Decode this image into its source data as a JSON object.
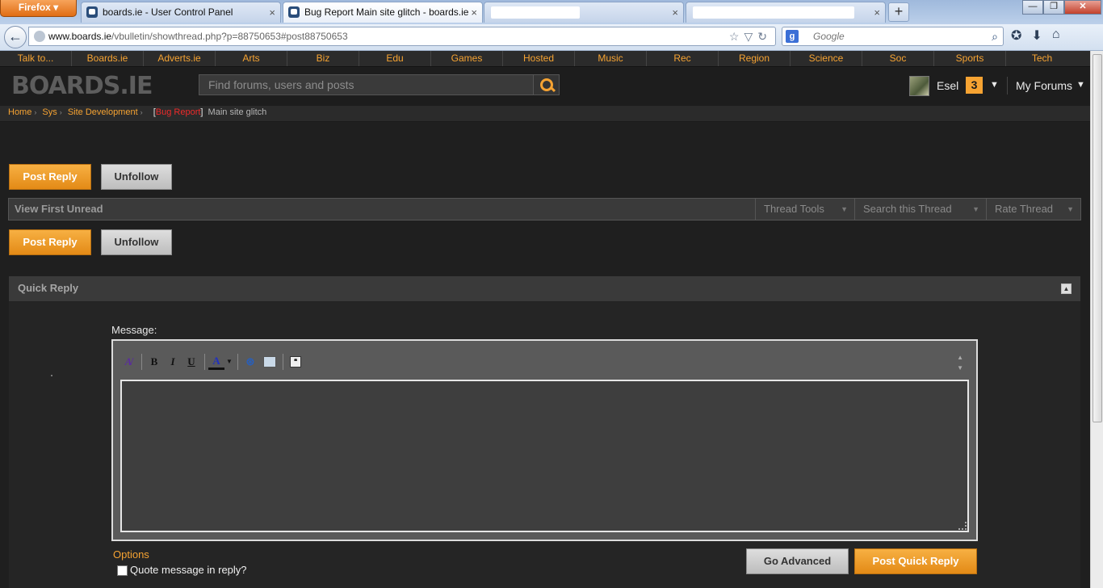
{
  "browser": {
    "app_button": "Firefox",
    "tabs": [
      {
        "title": "boards.ie - User Control Panel",
        "close": "×"
      },
      {
        "title": "Bug Report Main site glitch - boards.ie",
        "close": "×"
      },
      {
        "title": "",
        "close": "×"
      },
      {
        "title": "",
        "close": "×"
      }
    ],
    "new_tab": "+",
    "url_host": "www.boards.ie",
    "url_path": "/vbulletin/showthread.php?p=88750653#post88750653",
    "search_placeholder": "Google",
    "search_engine_glyph": "g"
  },
  "site": {
    "categories": [
      "Talk to...",
      "Boards.ie",
      "Adverts.ie",
      "Arts",
      "Biz",
      "Edu",
      "Games",
      "Hosted",
      "Music",
      "Rec",
      "Region",
      "Science",
      "Soc",
      "Sports",
      "Tech"
    ],
    "logo": "BOARDS.IE",
    "search_placeholder": "Find forums, users and posts",
    "user": {
      "name": "Esel",
      "notifications": "3"
    },
    "my_forums": "My Forums",
    "accent": "#f6a332"
  },
  "breadcrumb": {
    "items": [
      "Home",
      "Sys",
      "Site Development"
    ],
    "prefix": "Bug Report",
    "current": "Main site glitch"
  },
  "thread": {
    "post_reply": "Post Reply",
    "unfollow": "Unfollow",
    "view_first_unread": "View First Unread",
    "tools": [
      "Thread Tools",
      "Search this Thread",
      "Rate Thread"
    ]
  },
  "quick_reply": {
    "title": "Quick Reply",
    "message_label": "Message:",
    "options_label": "Options",
    "quote_label": "Quote message in reply?",
    "go_advanced": "Go Advanced",
    "post_quick_reply": "Post Quick Reply"
  }
}
